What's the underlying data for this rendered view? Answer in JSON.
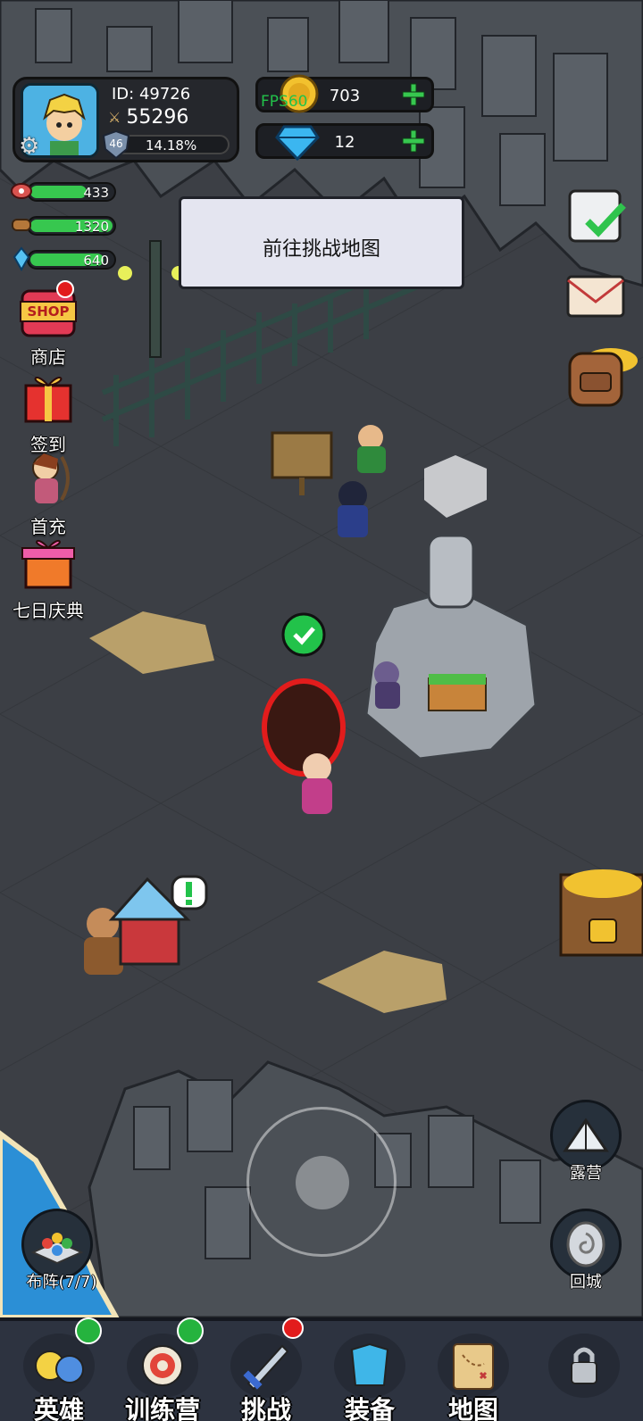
{
  "player": {
    "id_text": "ID:  49726",
    "power": "55296",
    "level": "46",
    "exp_percent": "14.18%",
    "exp_fraction": 0.1418
  },
  "currency": {
    "gold": "703",
    "gems": "12",
    "fps": "FPS60"
  },
  "resources": [
    {
      "name": "meat-icon",
      "value": "433",
      "fill": 0.7
    },
    {
      "name": "wood-icon",
      "value": "1320",
      "fill": 1.0
    },
    {
      "name": "crystal-icon",
      "value": "640",
      "fill": 0.9
    }
  ],
  "side_menu": {
    "shop": "商店",
    "checkin": "签到",
    "first_recharge": "首充",
    "seven_day": "七日庆典",
    "shop_sign": "SHOP"
  },
  "tooltip": "前往挑战地图",
  "right_buttons": {
    "camp": "露营",
    "return_city": "回城"
  },
  "formation": "布阵(7/7)",
  "nav": {
    "heroes": "英雄",
    "training": "训练营",
    "challenge": "挑战",
    "equipment": "装备",
    "map": "地图"
  },
  "colors": {
    "ground": "#3d4046",
    "rock": "#4a4f55",
    "accent_green": "#2fc44d",
    "red_dot": "#e21c1c"
  }
}
